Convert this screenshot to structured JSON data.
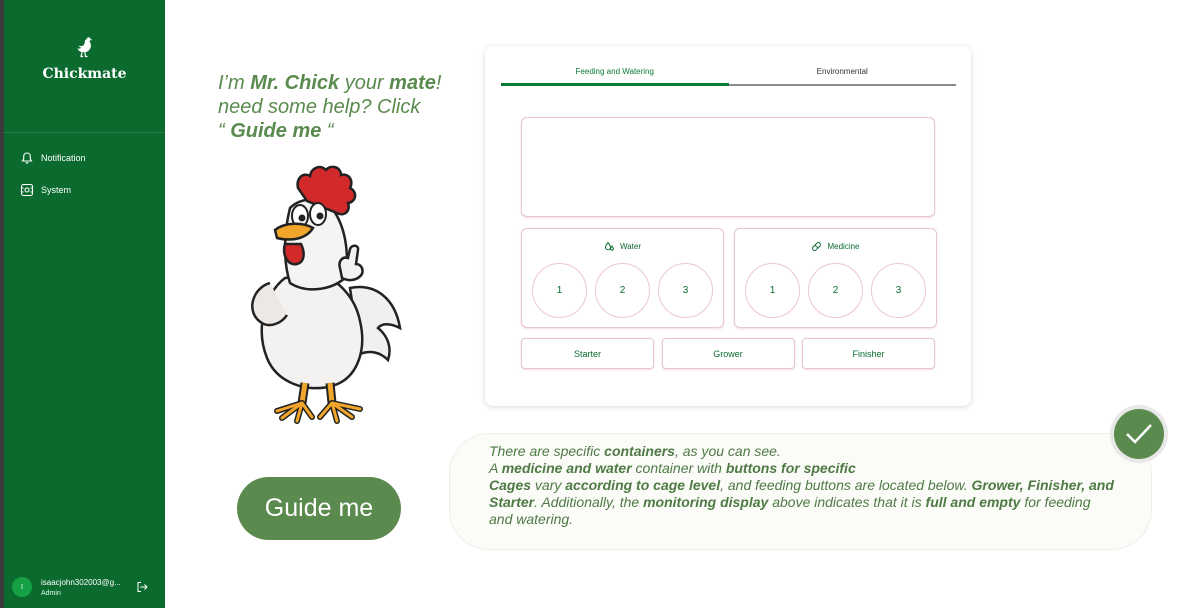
{
  "app": {
    "name": "Chickmate"
  },
  "sidebar": {
    "items": [
      {
        "label": "Notification",
        "icon": "bell-icon"
      },
      {
        "label": "System",
        "icon": "system-icon"
      }
    ],
    "user": {
      "initial": "I",
      "email": "isaacjohn302003@g...",
      "role": "Admin"
    }
  },
  "mascot": {
    "line1_prefix": "I’m ",
    "line1_bold1": "Mr. Chick",
    "line1_mid": " your ",
    "line1_bold2": "mate",
    "line1_suffix": "!",
    "line2": "need some help? Click",
    "line3_open": "“ ",
    "line3_bold": "Guide me",
    "line3_close": " “"
  },
  "guide_button": "Guide me",
  "tabs": [
    {
      "label": "Feeding and Watering",
      "active": true
    },
    {
      "label": "Environmental",
      "active": false
    }
  ],
  "water": {
    "title": "Water",
    "cages": [
      "1",
      "2",
      "3"
    ]
  },
  "medicine": {
    "title": "Medicine",
    "cages": [
      "1",
      "2",
      "3"
    ]
  },
  "feed_buttons": [
    "Starter",
    "Grower",
    "Finisher"
  ],
  "info": {
    "t1": "There are specific ",
    "b1": "containers",
    "t2": ", as you can see.",
    "t3": "A ",
    "b2": "medicine and water",
    "t4": " container with ",
    "b3": "buttons for specific",
    "b4": "Cages",
    "t5": " vary ",
    "b5": "according to cage level",
    "t6": ", and feeding buttons are located below. ",
    "b6": "Grower, Finisher, and",
    "b7": "Starter",
    "t7": ".  Additionally, the ",
    "b8": "monitoring display",
    "t8": " above indicates that it is ",
    "b9": "full and empty",
    "t9": " for feeding",
    "t10": "and watering."
  },
  "colors": {
    "sidebar": "#0b6b2f",
    "accent": "#5a8a4e",
    "tab_active": "#0b7a34"
  }
}
